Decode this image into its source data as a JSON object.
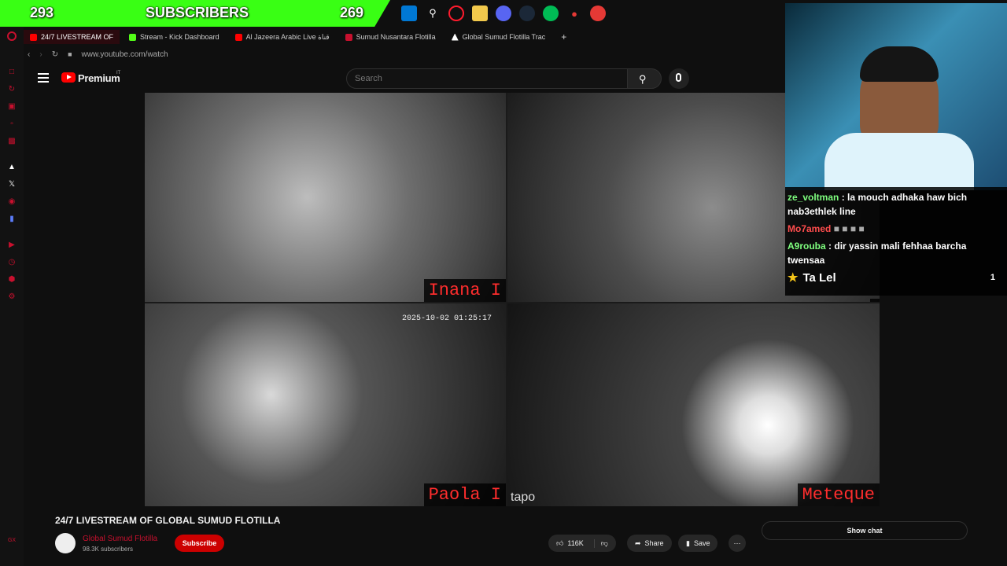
{
  "overlay": {
    "left_count": "293",
    "label": "SUBSCRIBERS",
    "right_count": "269"
  },
  "taskbar": {
    "icons": [
      "windows-icon",
      "search-icon",
      "opera-icon",
      "folder-icon",
      "discord-icon",
      "steam-icon",
      "app-icon",
      "maps-icon",
      "obs-icon"
    ]
  },
  "browser": {
    "tabs": [
      {
        "label": "24/7 LIVESTREAM OF",
        "color": "#ff0000"
      },
      {
        "label": "Stream - Kick Dashboard",
        "color": "#53fc18"
      },
      {
        "label": "Al Jazeera Arabic Live قناة",
        "color": "#ff0000"
      },
      {
        "label": "Sumud Nusantara Flotilla",
        "color": "#c8102e"
      },
      {
        "label": "Global Sumud Flotilla Trac",
        "color": "#ffffff"
      }
    ],
    "new_tab": "+",
    "url": "www.youtube.com/watch"
  },
  "youtube": {
    "brand": "Premium",
    "brand_sup": "IT",
    "search_placeholder": "Search"
  },
  "video": {
    "cameras": [
      {
        "name": "Inana I"
      },
      {
        "name": ""
      },
      {
        "name": "Paola I"
      },
      {
        "name": "Meteque"
      }
    ],
    "timestamp": "2025-10-02 01:25:17",
    "camera_brand": "tapo"
  },
  "chat": {
    "messages": [
      {
        "user": "ze_voltman",
        "user_color": "#7fff7f",
        "text": ": la mouch adhaka haw bich nab3ethlek line"
      },
      {
        "user": "Mo7amed",
        "user_color": "#ff4d4d",
        "text": ""
      },
      {
        "user": "A9rouba",
        "user_color": "#7fff7f",
        "text": ": dir yassin mali fehhaa barcha twensaa"
      }
    ],
    "leader": "Ta Lel",
    "leader_count": "1"
  },
  "below": {
    "title": "24/7 LIVESTREAM OF GLOBAL SUMUD FLOTILLA",
    "channel": "Global Sumud Flotilla",
    "subs": "98.3K subscribers",
    "subscribe": "Subscribe",
    "likes": "116K",
    "share": "Share",
    "save": "Save",
    "show_chat": "Show chat"
  }
}
